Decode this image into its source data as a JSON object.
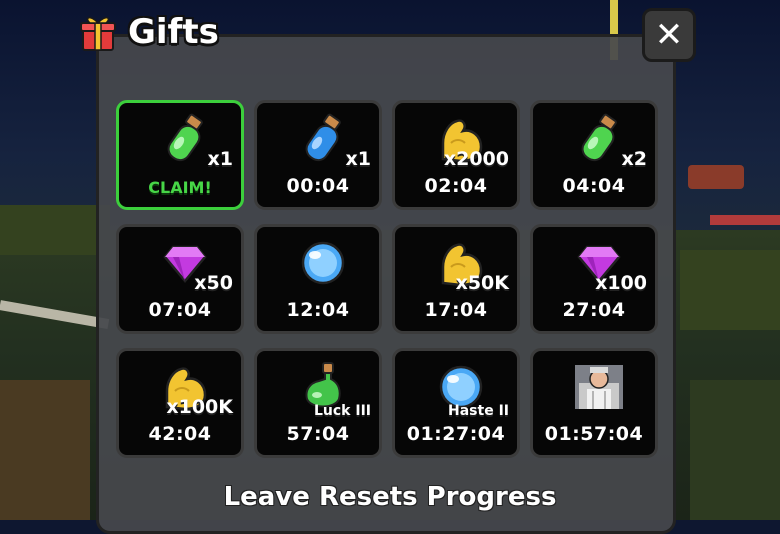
{
  "header": {
    "title": "Gifts",
    "icon": "gift-box-icon"
  },
  "close": {
    "label": "✕",
    "icon": "close-icon"
  },
  "colors": {
    "claim_green": "#47d647",
    "panel": "#46484c",
    "cell_bg": "#060606"
  },
  "gifts": [
    {
      "icon": "green-potion-icon",
      "qty": "x1",
      "status": "CLAIM!",
      "claimable": true
    },
    {
      "icon": "blue-potion-icon",
      "qty": "x1",
      "status": "00:04"
    },
    {
      "icon": "strength-arm-icon",
      "qty": "x2000",
      "status": "02:04"
    },
    {
      "icon": "green-potion-icon",
      "qty": "x2",
      "status": "04:04"
    },
    {
      "icon": "purple-gem-icon",
      "qty": "x50",
      "status": "07:04"
    },
    {
      "icon": "blue-orb-icon",
      "qty": "",
      "status": "12:04"
    },
    {
      "icon": "strength-arm-icon",
      "qty": "x50K",
      "status": "17:04"
    },
    {
      "icon": "purple-gem-icon",
      "qty": "x100",
      "status": "27:04"
    },
    {
      "icon": "strength-arm-icon",
      "qty": "x100K",
      "status": "42:04"
    },
    {
      "icon": "luck-potion-icon",
      "qty": "Luck III",
      "status": "57:04"
    },
    {
      "icon": "haste-orb-icon",
      "qty": "Haste II",
      "status": "01:27:04"
    },
    {
      "icon": "character-portrait-icon",
      "qty": "",
      "status": "01:57:04"
    }
  ],
  "footer": {
    "text": "Leave Resets Progress"
  }
}
